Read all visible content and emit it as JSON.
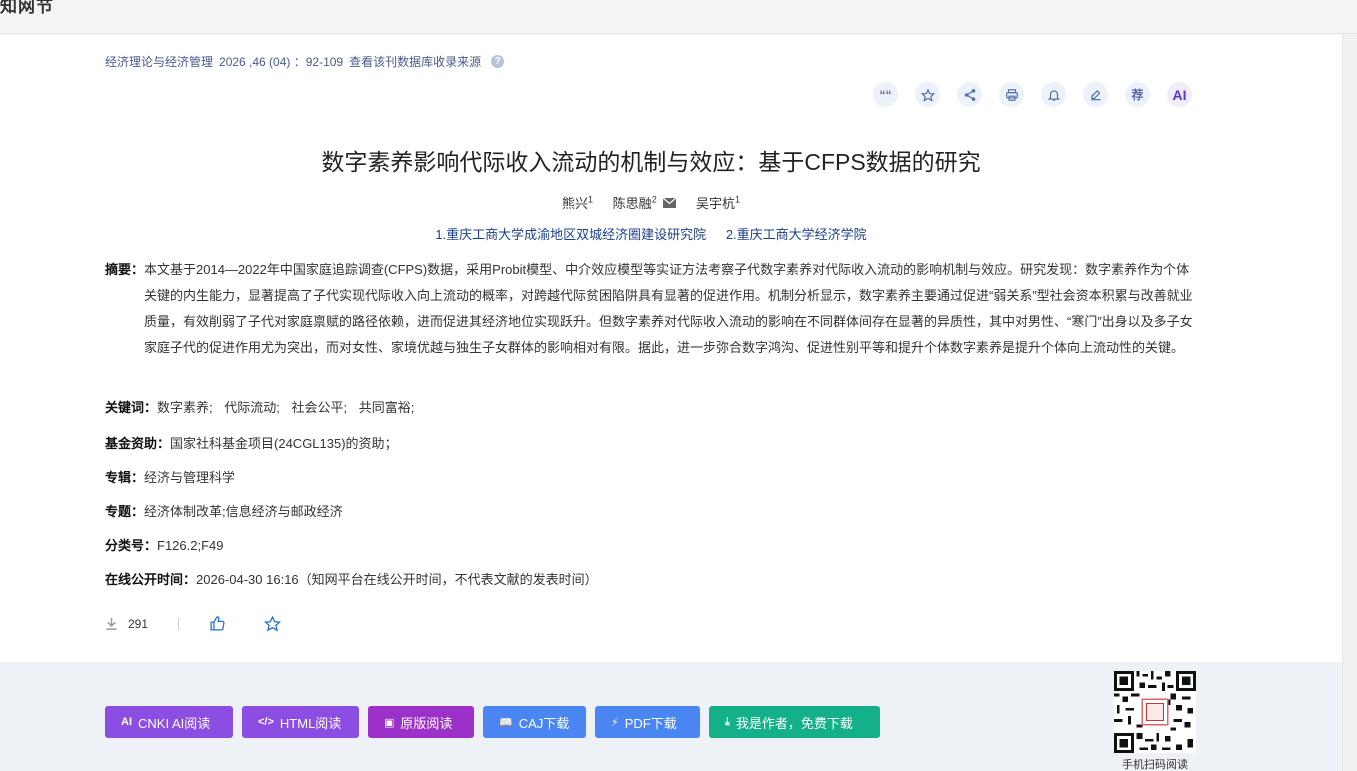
{
  "site": {
    "title": "知网节"
  },
  "source": {
    "journal": "经济理论与经济管理",
    "issue": "2026 ,46 (04) ：92-109",
    "db_link": "查看该刊数据库收录来源"
  },
  "tools": [
    {
      "name": "quote-icon",
      "label": "“"
    },
    {
      "name": "favorite-icon",
      "label": ""
    },
    {
      "name": "share-icon",
      "label": ""
    },
    {
      "name": "print-icon",
      "label": ""
    },
    {
      "name": "bell-icon",
      "label": ""
    },
    {
      "name": "edit-icon",
      "label": ""
    },
    {
      "name": "recommend-icon",
      "label": "荐"
    },
    {
      "name": "ai-icon",
      "label": "AI"
    }
  ],
  "article": {
    "title": "数字素养影响代际收入流动的机制与效应：基于CFPS数据的研究",
    "authors": [
      {
        "name": "熊兴",
        "sup": "1"
      },
      {
        "name": "陈思融",
        "sup": "2"
      },
      {
        "name": "吴宇杭",
        "sup": "1"
      }
    ],
    "affiliations": [
      "1.重庆工商大学成渝地区双城经济圈建设研究院",
      "2.重庆工商大学经济学院"
    ],
    "abstract_label": "摘要：",
    "abstract": "本文基于2014—2022年中国家庭追踪调查(CFPS)数据，采用Probit模型、中介效应模型等实证方法考察子代数字素养对代际收入流动的影响机制与效应。研究发现：数字素养作为个体关键的内生能力，显著提高了子代实现代际收入向上流动的概率，对跨越代际贫困陷阱具有显著的促进作用。机制分析显示，数字素养主要通过促进“弱关系”型社会资本积累与改善就业质量，有效削弱了子代对家庭禀赋的路径依赖，进而促进其经济地位实现跃升。但数字素养对代际收入流动的影响在不同群体间存在显著的异质性，其中对男性、“寒门”出身以及多子女家庭子代的促进作用尤为突出，而对女性、家境优越与独生子女群体的影响相对有限。据此，进一步弥合数字鸿沟、促进性别平等和提升个体数字素养是提升个体向上流动性的关键。",
    "keywords_label": "关键词：",
    "keywords": [
      "数字素养;",
      "代际流动;",
      "社会公平;",
      "共同富裕;"
    ],
    "fund_label": "基金资助：",
    "fund": "国家社科基金项目(24CGL135)的资助；",
    "album_label": "专辑：",
    "album": "经济与管理科学",
    "topic_label": "专题：",
    "topic": "经济体制改革;信息经济与邮政经济",
    "class_label": "分类号：",
    "class": "F126.2;F49",
    "online_label": "在线公开时间：",
    "online": "2026-04-30 16:16（知网平台在线公开时间，不代表文献的发表时间）"
  },
  "stats": {
    "downloads": "291"
  },
  "footer": {
    "buttons": [
      {
        "label": "CNKI AI阅读",
        "icon": "AI"
      },
      {
        "label": "HTML阅读",
        "icon": "</>"
      },
      {
        "label": "原版阅读",
        "icon": "▣"
      },
      {
        "label": "CAJ下载",
        "icon": "📖"
      },
      {
        "label": "PDF下载",
        "icon": "⚡"
      },
      {
        "label": "我是作者，免费下载",
        "icon": "⤓"
      }
    ],
    "qr_caption": "手机扫码阅读"
  }
}
